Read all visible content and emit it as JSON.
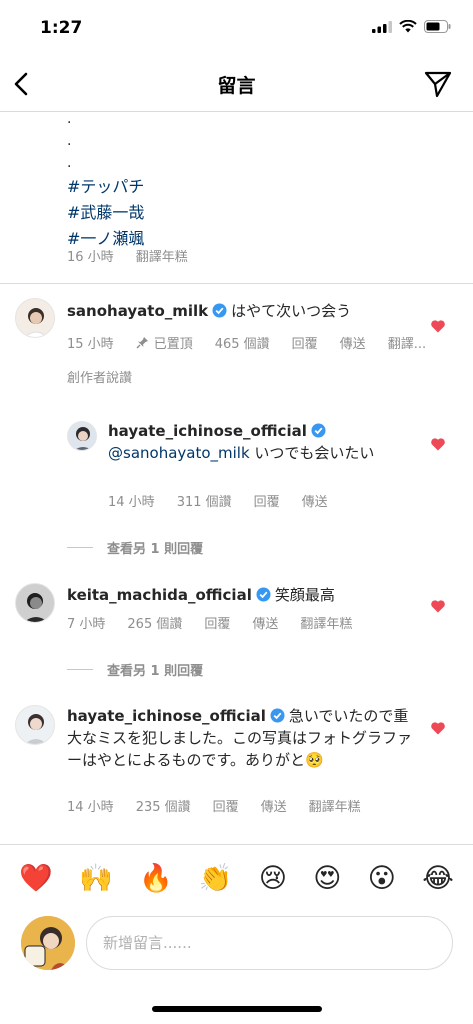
{
  "status_bar": {
    "time": "1:27"
  },
  "header": {
    "title": "留言"
  },
  "caption": {
    "dots": [
      ".",
      ".",
      "."
    ],
    "hashtags": [
      "#テッパチ",
      "#武藤一哉",
      "#一ノ瀬颯"
    ],
    "time": "16 小時",
    "translate": "翻譯年糕"
  },
  "comments": [
    {
      "username": "sanohayato_milk",
      "text": "はやて次いつ会う",
      "time": "15 小時",
      "pinned": "已置頂",
      "likes": "465 個讚",
      "reply": "回覆",
      "send": "傳送",
      "translate": "翻譯...",
      "author_liked": "創作者說讚"
    },
    {
      "username": "hayate_ichinose_official",
      "mention": "@sanohayato_milk",
      "text": " いつでも会いたい",
      "time": "14 小時",
      "likes": "311 個讚",
      "reply": "回覆",
      "send": "傳送"
    },
    {
      "username": "keita_machida_official",
      "text": "笑顔最高",
      "time": "7 小時",
      "likes": "265 個讚",
      "reply": "回覆",
      "send": "傳送",
      "translate": "翻譯年糕"
    },
    {
      "username": "hayate_ichinose_official",
      "text": "急いでいたので重大なミスを犯しました。この写真はフォトグラファーはやとによるものです。ありがと🥺",
      "time": "14 小時",
      "likes": "235 個讚",
      "reply": "回覆",
      "send": "傳送",
      "translate": "翻譯年糕"
    }
  ],
  "view_more_replies": [
    "查看另 1 則回覆",
    "查看另 1 則回覆"
  ],
  "emoji_bar": [
    "❤️",
    "🙌",
    "🔥",
    "👏",
    "😢",
    "😍",
    "😮",
    "😂"
  ],
  "input": {
    "placeholder": "新增留言......"
  },
  "colors": {
    "heart": "#ed4956",
    "link": "#00376b",
    "verified": "#3897f0",
    "meta": "#8e8e8e"
  }
}
